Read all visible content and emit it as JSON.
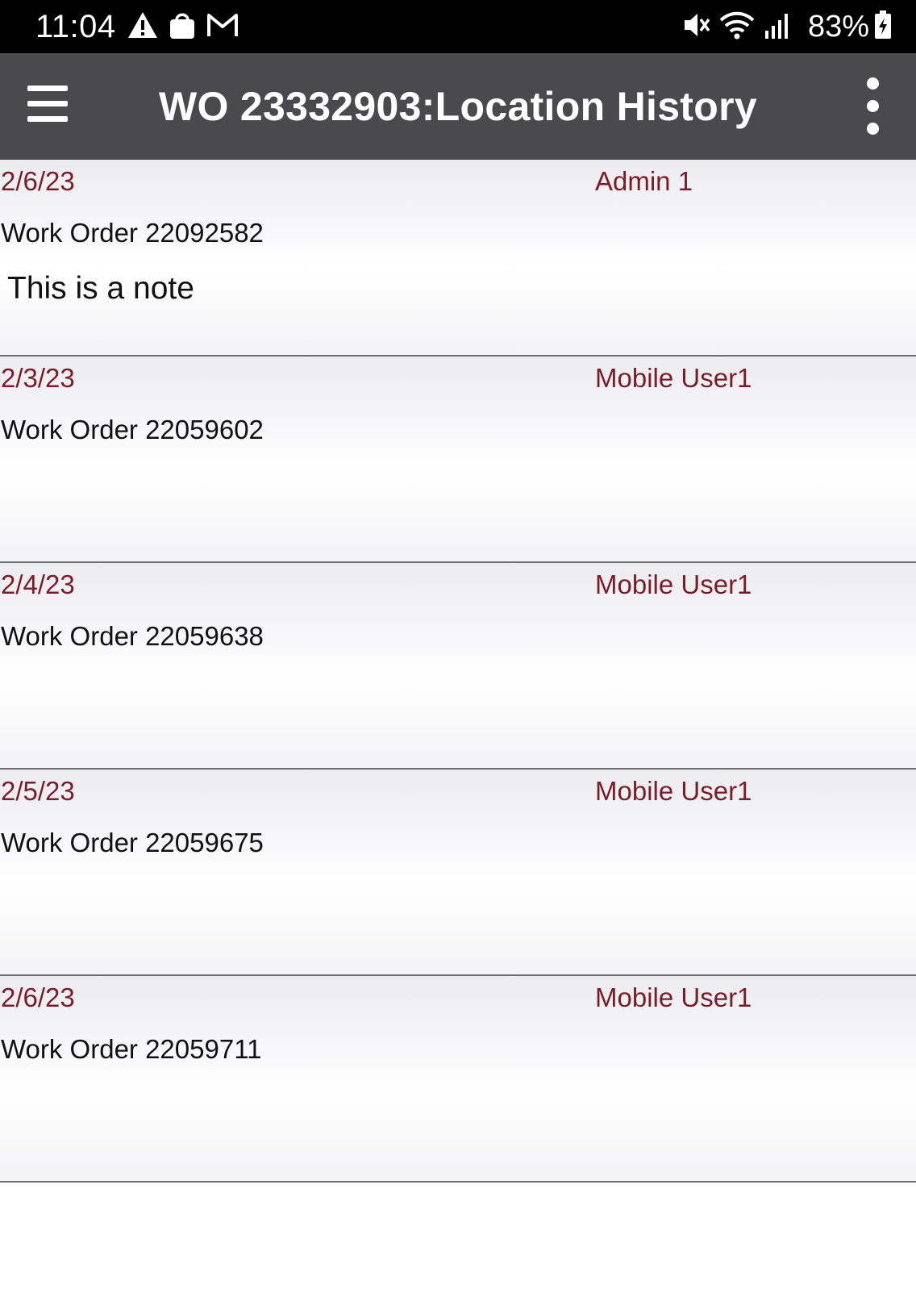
{
  "status_bar": {
    "time": "11:04",
    "left_icons": [
      "warning-icon",
      "shopping-bag-icon",
      "gmail-icon"
    ],
    "right_icons": [
      "mute-icon",
      "wifi-icon",
      "signal-icon",
      "battery-charging-icon"
    ],
    "battery": "83%"
  },
  "app_bar": {
    "title": "WO 23332903:Location History",
    "background": "#4a4a4c"
  },
  "colors": {
    "accent_text": "#7a1c2a",
    "divider": "#6d6d70"
  },
  "history": [
    {
      "date": "2/6/23",
      "user": "Admin 1",
      "title": "Work Order 22092582",
      "note": "This is a note"
    },
    {
      "date": "2/3/23",
      "user": "Mobile User1",
      "title": "Work Order 22059602",
      "note": ""
    },
    {
      "date": "2/4/23",
      "user": "Mobile User1",
      "title": "Work Order 22059638",
      "note": ""
    },
    {
      "date": "2/5/23",
      "user": "Mobile User1",
      "title": "Work Order 22059675",
      "note": ""
    },
    {
      "date": "2/6/23",
      "user": "Mobile User1",
      "title": "Work Order 22059711",
      "note": ""
    }
  ]
}
